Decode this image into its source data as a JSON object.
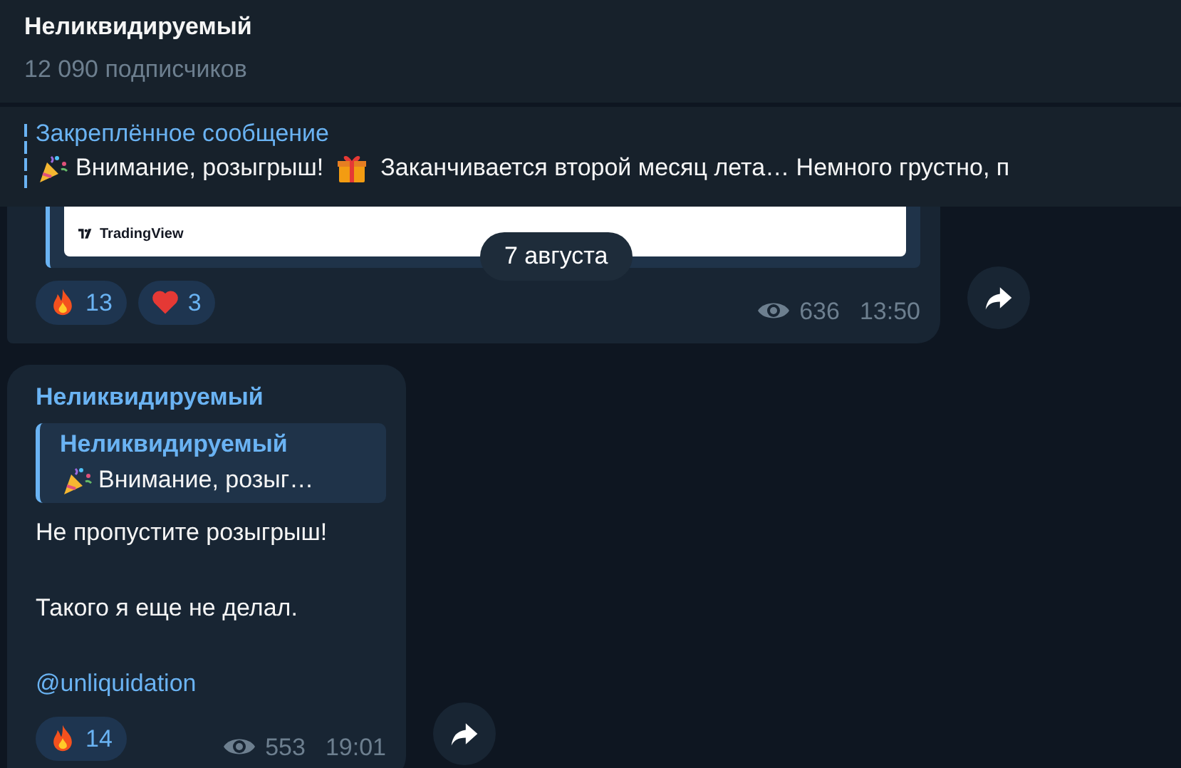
{
  "header": {
    "title": "Неликвидируемый",
    "subtitle": "12 090 подписчиков"
  },
  "pinned": {
    "title": "Закреплённое сообщение",
    "text_1": "Внимание, розыгрыш!",
    "text_2": "Заканчивается второй месяц лета… Немного грустно, п"
  },
  "date_badge": "7 августа",
  "messages": [
    {
      "embed": {
        "source": "TradingView"
      },
      "reactions": [
        {
          "kind": "fire",
          "count": "13"
        },
        {
          "kind": "heart",
          "count": "3"
        }
      ],
      "views": "636",
      "time": "13:50"
    },
    {
      "author": "Неликвидируемый",
      "reply": {
        "author": "Неликвидируемый",
        "text": "Внимание, розыг…"
      },
      "lines": [
        {
          "kind": "text",
          "text": "Не пропустите розыгрыш!"
        },
        {
          "kind": "blank"
        },
        {
          "kind": "text",
          "text": "Такого я еще не делал."
        },
        {
          "kind": "blank"
        },
        {
          "kind": "link",
          "text": "@unliquidation"
        }
      ],
      "reactions": [
        {
          "kind": "fire",
          "count": "14"
        }
      ],
      "views": "553",
      "time": "19:01"
    }
  ]
}
